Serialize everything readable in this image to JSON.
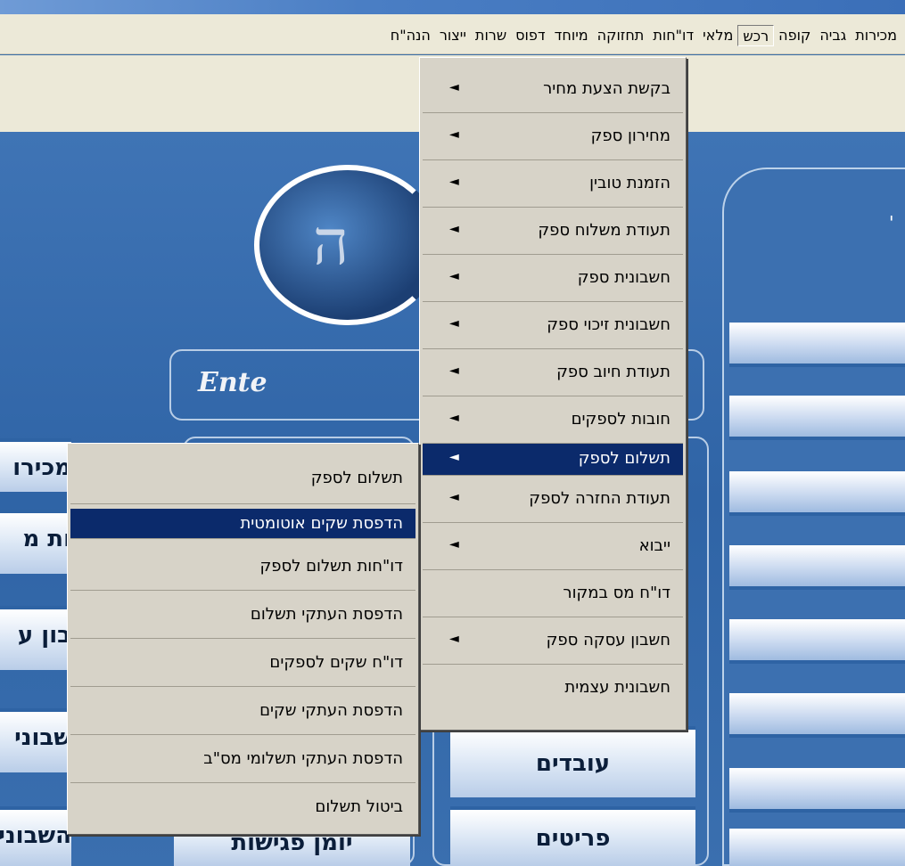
{
  "menubar": {
    "items": [
      "מכירות",
      "גביה",
      "קופה",
      "רכש",
      "מלאי",
      "דו\"חות",
      "תחזוקה",
      "מיוחד",
      "דפוס",
      "שרות",
      "ייצור",
      "הנה\"ח"
    ],
    "active_index": 3
  },
  "background": {
    "logo_text": "Ente",
    "tiles": {
      "employees": "עובדים",
      "meetings_diary": "יומן פגישות",
      "details": "פריטים",
      "left_sales": "מכירו",
      "left_1": "ות מ",
      "left_2": "בון ע",
      "left_3": "שבוני",
      "left_4": "השבוני"
    }
  },
  "purchase_menu": {
    "items": [
      {
        "label": "בקשת הצעת מחיר",
        "has_submenu": true
      },
      {
        "label": "מחירון ספק",
        "has_submenu": true
      },
      {
        "label": "הזמנת טובין",
        "has_submenu": true
      },
      {
        "label": "תעודת משלוח ספק",
        "has_submenu": true
      },
      {
        "label": "חשבונית ספק",
        "has_submenu": true
      },
      {
        "label": "חשבונית זיכוי ספק",
        "has_submenu": true
      },
      {
        "label": "תעודת חיוב ספק",
        "has_submenu": true
      },
      {
        "label": "חובות לספקים",
        "has_submenu": true
      },
      {
        "label": "תשלום לספק",
        "has_submenu": true,
        "selected": true
      },
      {
        "label": "תעודת החזרה לספק",
        "has_submenu": true
      },
      {
        "label": "ייבוא",
        "has_submenu": true
      },
      {
        "label": "דו\"ח מס במקור",
        "has_submenu": false
      },
      {
        "label": "חשבון עסקה ספק",
        "has_submenu": true
      },
      {
        "label": "חשבונית עצמית",
        "has_submenu": false
      }
    ]
  },
  "payment_submenu": {
    "items": [
      {
        "label": "תשלום לספק"
      },
      {
        "label": "הדפסת שקים אוטומטית",
        "selected": true
      },
      {
        "label": "דו\"חות תשלום לספק"
      },
      {
        "label": "הדפסת העתקי תשלום"
      },
      {
        "label": "דו\"ח שקים לספקים"
      },
      {
        "label": "הדפסת העתקי שקים"
      },
      {
        "label": "הדפסת העתקי תשלומי מס\"ב"
      },
      {
        "label": "ביטול תשלום"
      }
    ]
  },
  "icons": {
    "submenu_arrow": "◄"
  }
}
